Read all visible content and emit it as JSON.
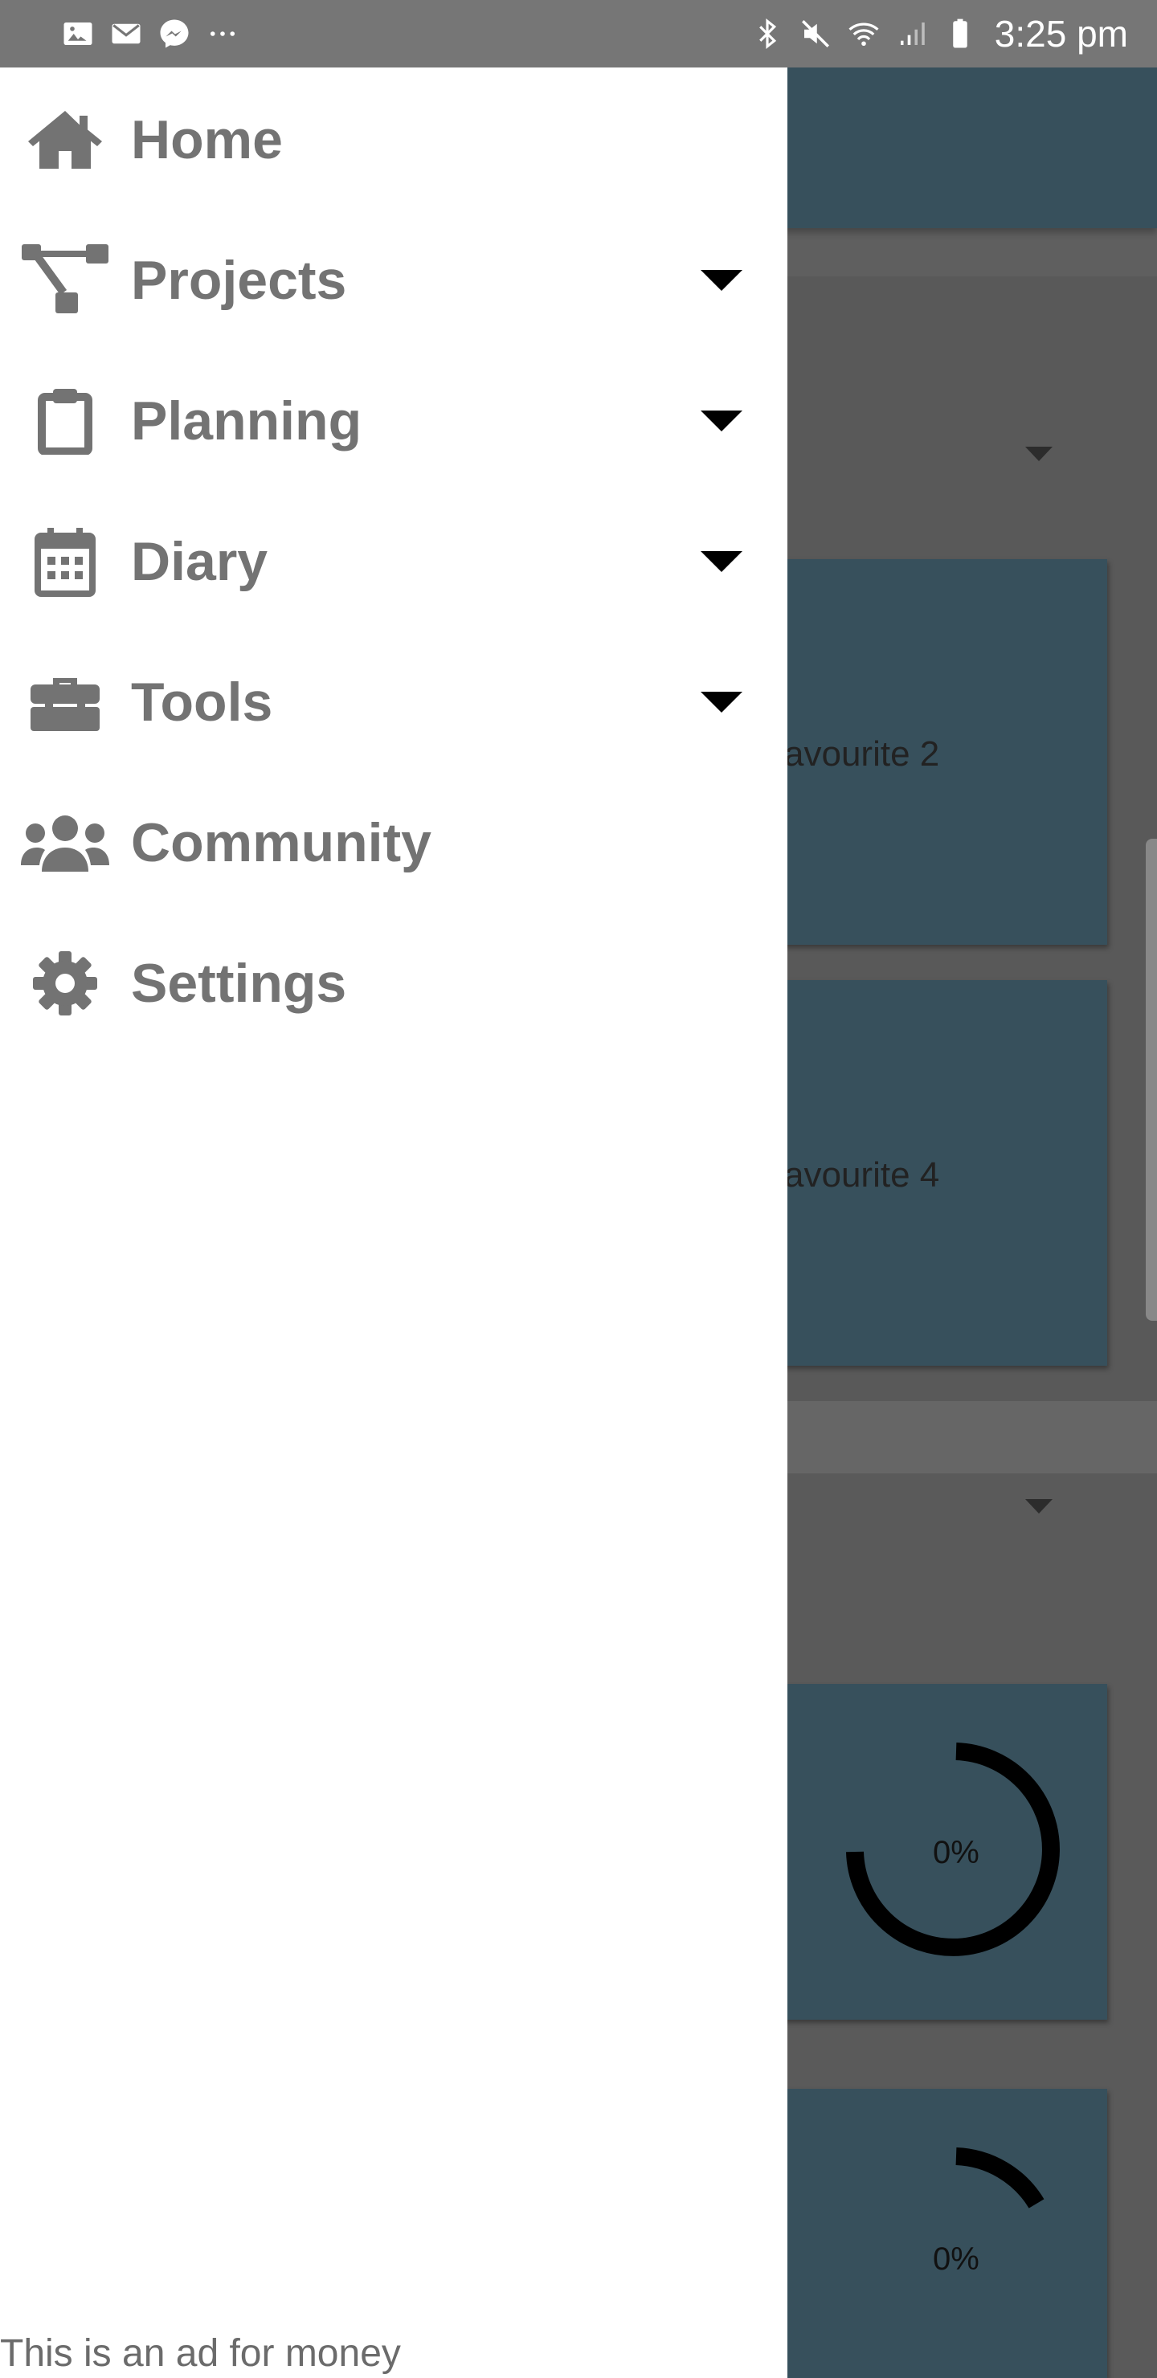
{
  "status_bar": {
    "time": "3:25 pm",
    "left_icons": [
      "image-icon",
      "mail-icon",
      "messenger-icon",
      "more-dots-icon"
    ],
    "right_icons": [
      "bluetooth-icon",
      "mute-icon",
      "wifi-icon",
      "signal-icon",
      "battery-icon"
    ]
  },
  "drawer": {
    "items": [
      {
        "label": "Home",
        "icon": "home-icon",
        "expandable": false
      },
      {
        "label": "Projects",
        "icon": "sitemap-icon",
        "expandable": true
      },
      {
        "label": "Planning",
        "icon": "clipboard-icon",
        "expandable": true
      },
      {
        "label": "Diary",
        "icon": "calendar-icon",
        "expandable": true
      },
      {
        "label": "Tools",
        "icon": "toolbox-icon",
        "expandable": true
      },
      {
        "label": "Community",
        "icon": "users-icon",
        "expandable": false
      },
      {
        "label": "Settings",
        "icon": "gear-icon",
        "expandable": false
      }
    ],
    "footer_ad": "This is an ad for money"
  },
  "background": {
    "cards": [
      {
        "label": "avourite 2"
      },
      {
        "label": "avourite 4"
      }
    ],
    "gauges": [
      {
        "label": "0%"
      },
      {
        "label": "0%"
      }
    ]
  },
  "colors": {
    "status_bar": "#767676",
    "drawer_bg": "#ffffff",
    "nav_text": "#737373",
    "card_bg": "#37505c"
  }
}
